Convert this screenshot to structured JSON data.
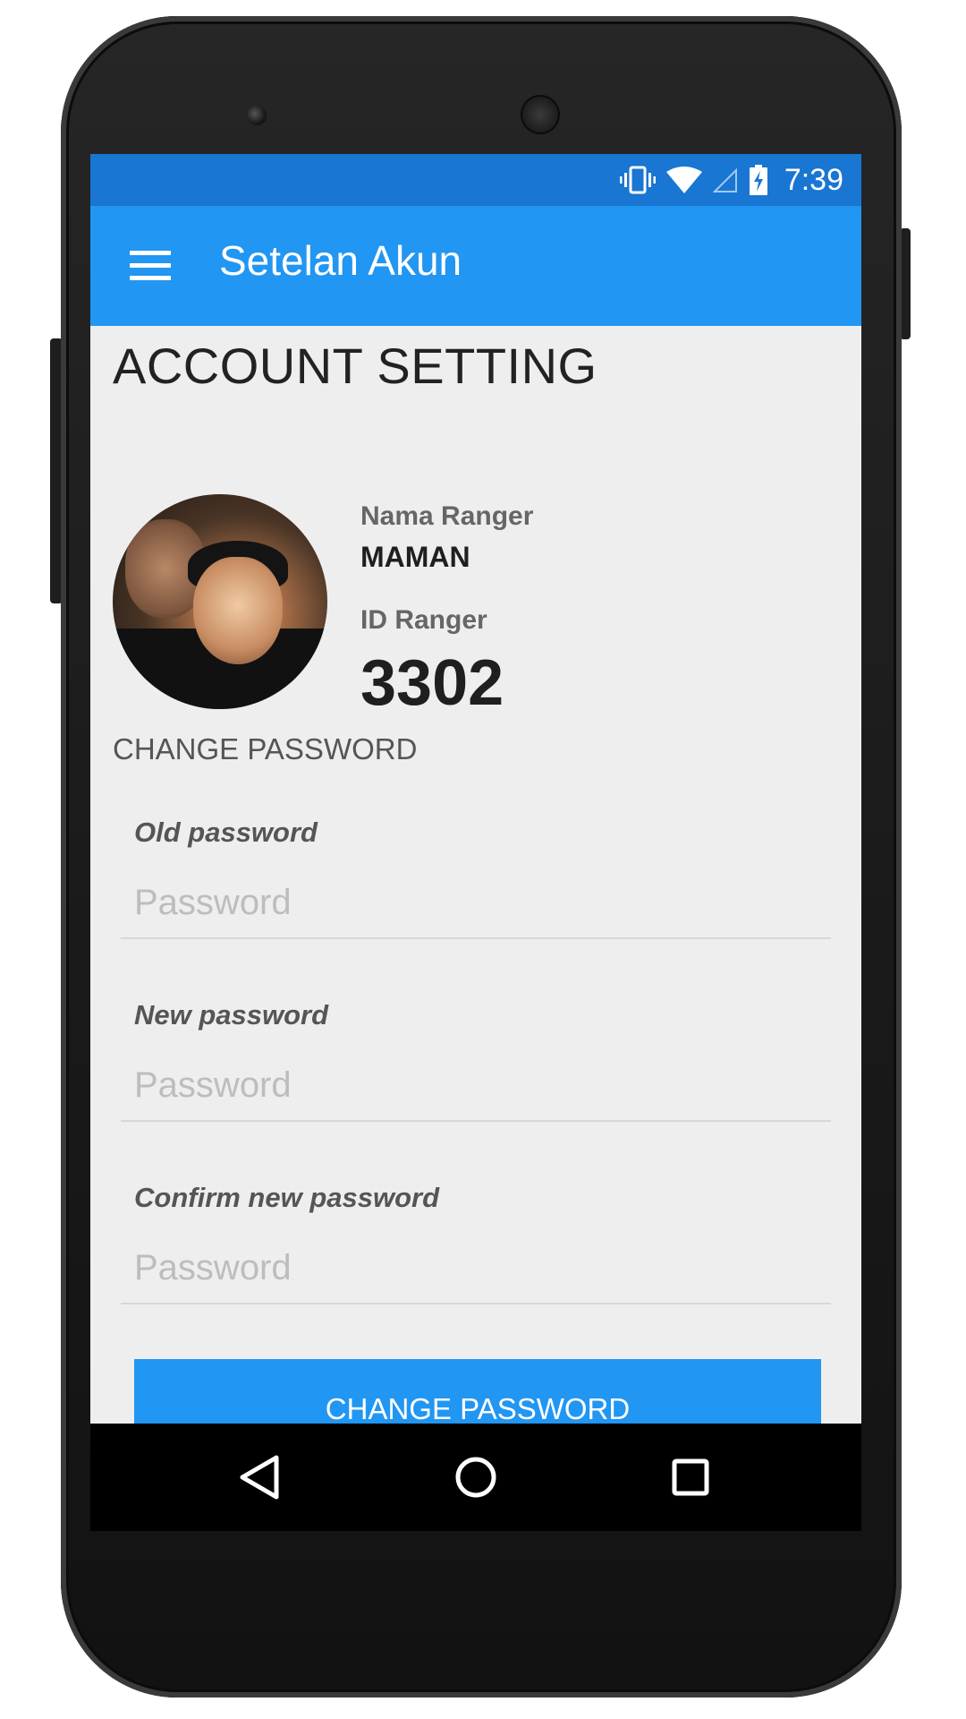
{
  "status_bar": {
    "time": "7:39",
    "icons": [
      "vibrate-icon",
      "wifi-icon",
      "signal-icon",
      "battery-charging-icon"
    ]
  },
  "app_bar": {
    "title": "Setelan Akun",
    "menu_icon": "menu-icon"
  },
  "page": {
    "title": "ACCOUNT SETTING"
  },
  "profile": {
    "name_label": "Nama Ranger",
    "name_value": "MAMAN",
    "id_label": "ID Ranger",
    "id_value": "3302"
  },
  "change_password": {
    "section_title": "CHANGE PASSWORD",
    "fields": [
      {
        "label": "Old password",
        "placeholder": "Password",
        "value": ""
      },
      {
        "label": "New password",
        "placeholder": "Password",
        "value": ""
      },
      {
        "label": "Confirm new password",
        "placeholder": "Password",
        "value": ""
      }
    ],
    "submit_label": "CHANGE PASSWORD"
  },
  "nav_bar": {
    "buttons": [
      "back-icon",
      "home-icon",
      "recents-icon"
    ]
  },
  "colors": {
    "status_bar": "#1976d2",
    "app_bar": "#2196f3",
    "background": "#eeeeee",
    "button": "#2196f3"
  }
}
